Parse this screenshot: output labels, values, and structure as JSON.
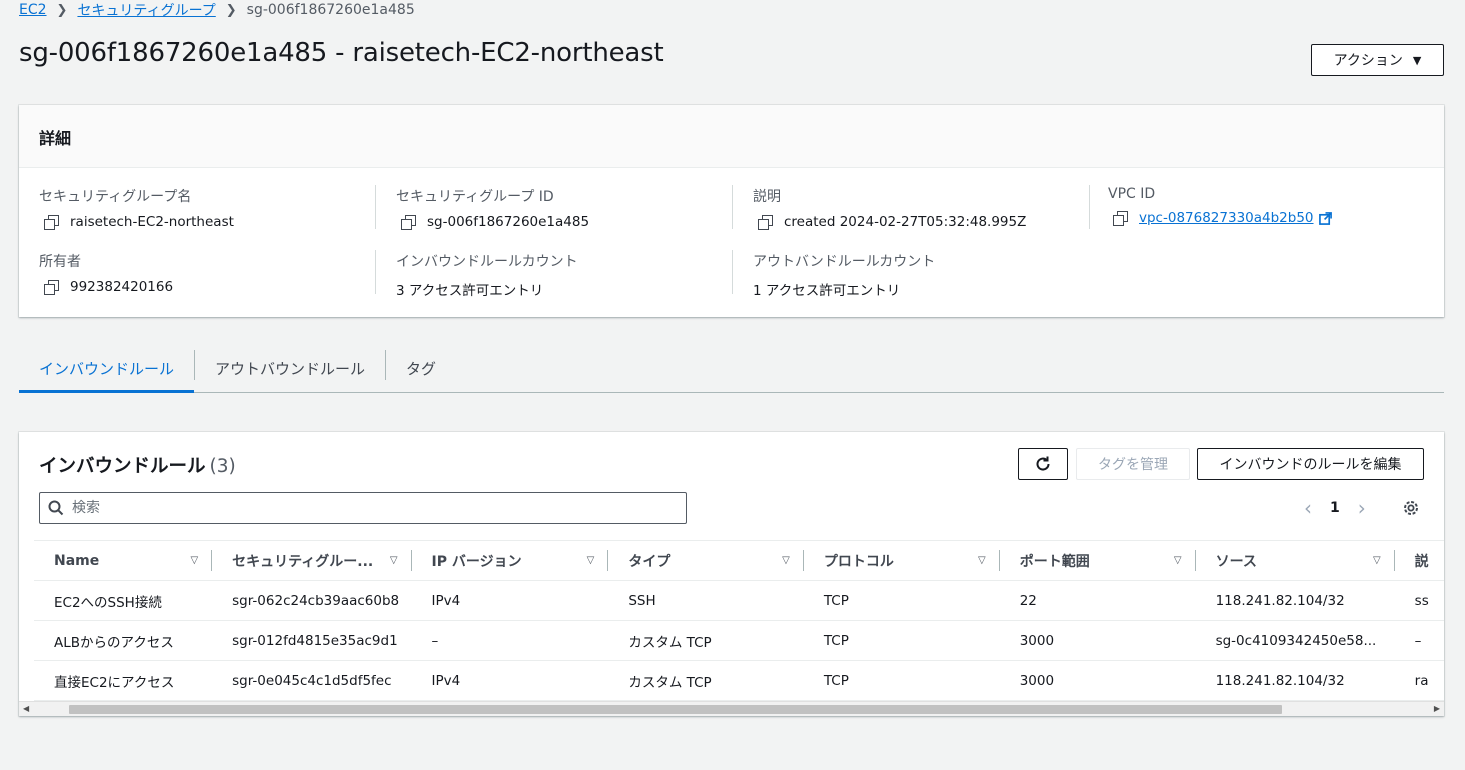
{
  "breadcrumb": {
    "items": [
      "EC2",
      "セキュリティグループ"
    ],
    "current": "sg-006f1867260e1a485"
  },
  "page": {
    "title": "sg-006f1867260e1a485 - raisetech-EC2-northeast",
    "actions_label": "アクション"
  },
  "details": {
    "header": "詳細",
    "fields": [
      {
        "label": "セキュリティグループ名",
        "value": "raisetech-EC2-northeast"
      },
      {
        "label": "セキュリティグループ ID",
        "value": "sg-006f1867260e1a485"
      },
      {
        "label": "説明",
        "value": "created 2024-02-27T05:32:48.995Z"
      },
      {
        "label": "VPC ID",
        "value": "vpc-0876827330a4b2b50"
      },
      {
        "label": "所有者",
        "value": "992382420166"
      },
      {
        "label": "インバウンドルールカウント",
        "value": "3 アクセス許可エントリ"
      },
      {
        "label": "アウトバンドルールカウント",
        "value": "1 アクセス許可エントリ"
      }
    ]
  },
  "tabs": [
    "インバウンドルール",
    "アウトバウンドルール",
    "タグ"
  ],
  "rules": {
    "title": "インバウンドルール",
    "count": "(3)",
    "manage_tags_label": "タグを管理",
    "edit_label": "インバウンドのルールを編集",
    "search_placeholder": "検索",
    "page_number": "1",
    "columns": [
      "Name",
      "セキュリティグルー...",
      "IP バージョン",
      "タイプ",
      "プロトコル",
      "ポート範囲",
      "ソース",
      "説"
    ],
    "rows": [
      [
        "EC2へのSSH接続",
        "sgr-062c24cb39aac60b8",
        "IPv4",
        "SSH",
        "TCP",
        "22",
        "118.241.82.104/32",
        "ss"
      ],
      [
        "ALBからのアクセス",
        "sgr-012fd4815e35ac9d1",
        "–",
        "カスタム TCP",
        "TCP",
        "3000",
        "sg-0c4109342450e58...",
        "–"
      ],
      [
        "直接EC2にアクセス",
        "sgr-0e045c4c1d5df5fec",
        "IPv4",
        "カスタム TCP",
        "TCP",
        "3000",
        "118.241.82.104/32",
        "ra"
      ]
    ]
  },
  "icons": {
    "copy": "copy-icon",
    "external_link": "external-link-icon",
    "refresh": "refresh-icon",
    "search": "search-icon",
    "settings": "gear-icon"
  },
  "colors": {
    "link": "#0972d3",
    "background": "#f2f3f3",
    "text": "#16191f"
  }
}
